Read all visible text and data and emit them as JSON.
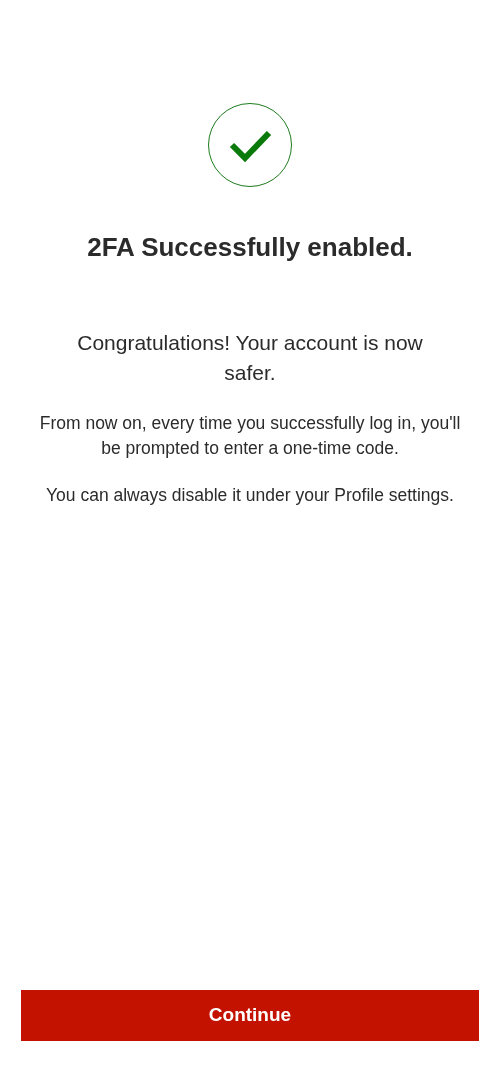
{
  "title": "2FA Successfully enabled.",
  "subtitle": "Congratulations! Your account is now safer.",
  "paragraphs": [
    "From now on, every time you successfully log in, you'll be prompted to enter a one-time code.",
    "You can always disable it under your Profile settings."
  ],
  "button": {
    "label": "Continue"
  }
}
